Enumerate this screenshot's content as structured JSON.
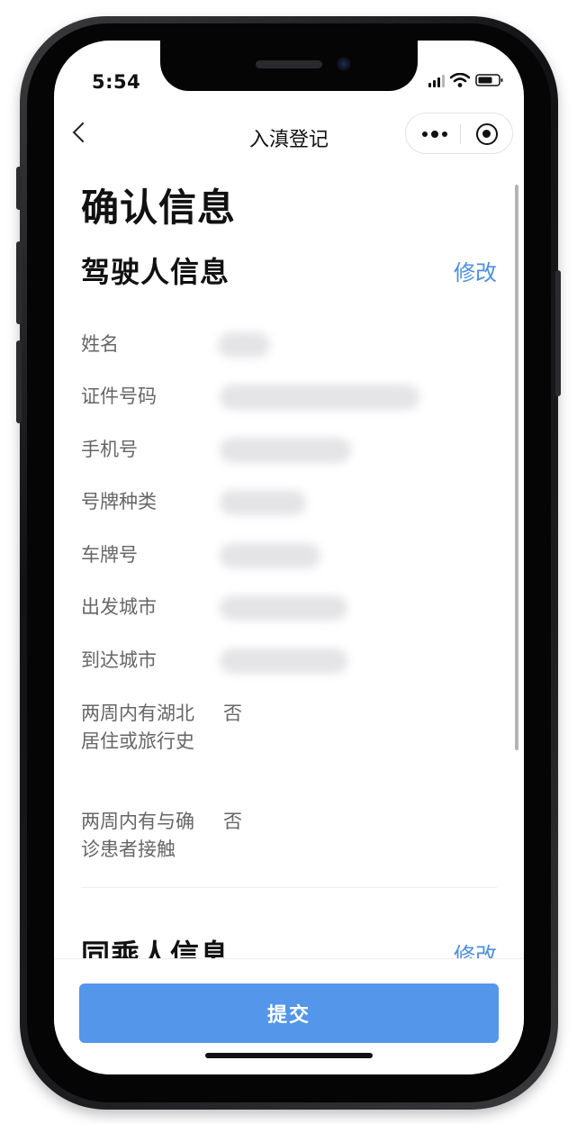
{
  "status_bar": {
    "time": "5:54"
  },
  "nav": {
    "title": "入滇登记"
  },
  "page": {
    "title": "确认信息"
  },
  "driver": {
    "section_title": "驾驶人信息",
    "edit_label": "修改",
    "rows": [
      {
        "label": "姓名",
        "value": ""
      },
      {
        "label": "证件号码",
        "value": ""
      },
      {
        "label": "手机号",
        "value": ""
      },
      {
        "label": "号牌种类",
        "value": ""
      },
      {
        "label": "车牌号",
        "value": ""
      },
      {
        "label": "出发城市",
        "value": ""
      },
      {
        "label": "到达城市",
        "value": ""
      },
      {
        "label": "两周内有湖北居住或旅行史",
        "value": "否"
      },
      {
        "label": "两周内有与确诊患者接触",
        "value": "否"
      }
    ]
  },
  "passenger": {
    "section_title": "同乘人信息",
    "edit_label": "修改"
  },
  "footer": {
    "submit_label": "提交"
  },
  "colors": {
    "accent": "#4a8fe2",
    "button": "#5396ea"
  }
}
